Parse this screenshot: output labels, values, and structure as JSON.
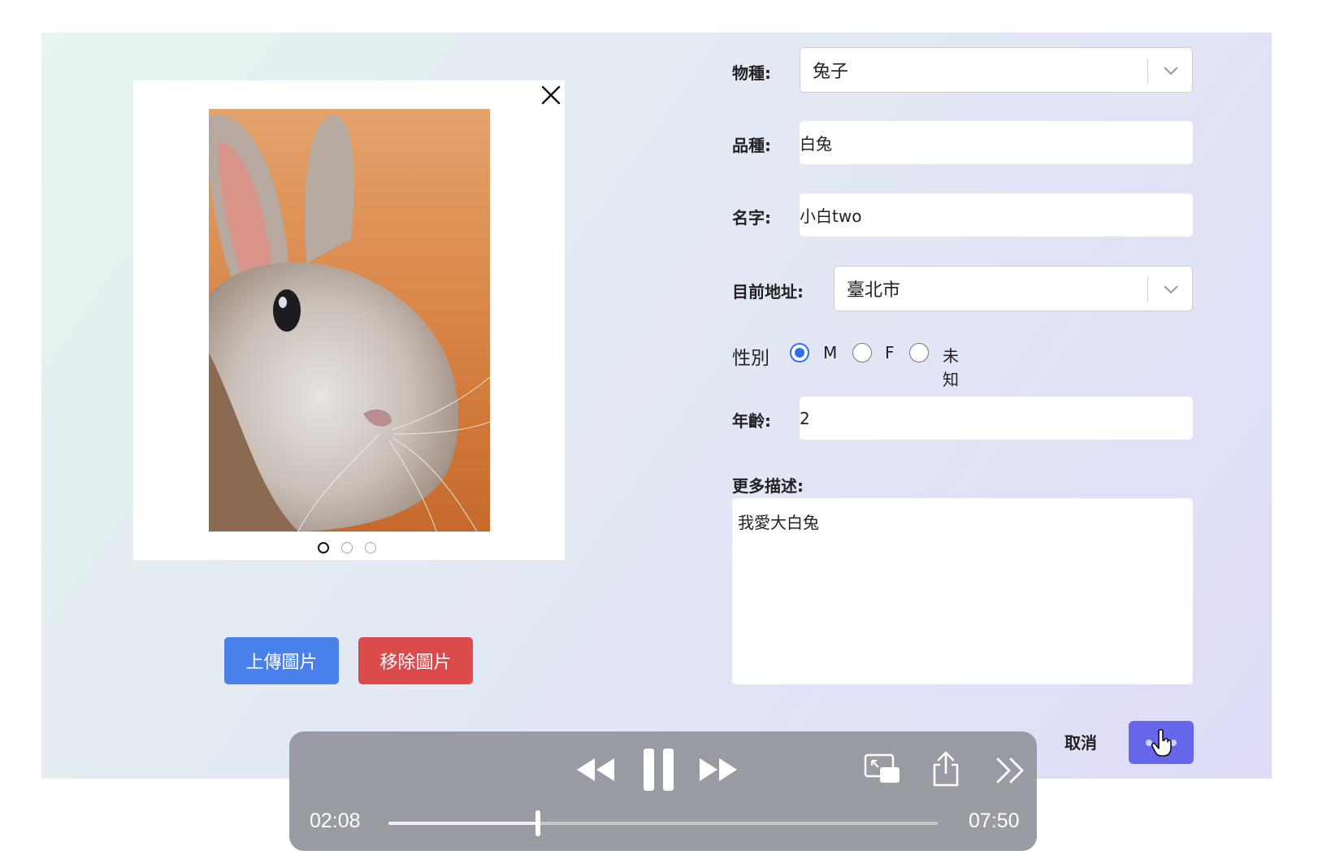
{
  "form": {
    "species": {
      "label": "物種:",
      "value": "兔子"
    },
    "breed": {
      "label": "品種:",
      "value": "白兔"
    },
    "name": {
      "label": "名字:",
      "value": "小白two"
    },
    "address": {
      "label": "目前地址:",
      "value": "臺北市"
    },
    "gender": {
      "label": "性別",
      "options": [
        "M",
        "F",
        "未知"
      ],
      "selected": "M"
    },
    "age": {
      "label": "年齡:",
      "value": "2"
    },
    "description": {
      "label": "更多描述:",
      "value": "我愛大白兔"
    },
    "cancel_label": "取消"
  },
  "image_panel": {
    "upload_label": "上傳圖片",
    "remove_label": "移除圖片",
    "carousel_count": 3,
    "carousel_active": 1
  },
  "player": {
    "current_time": "02:08",
    "total_time": "07:50",
    "progress": 0.2723
  },
  "colors": {
    "upload": "#4a80ea",
    "remove": "#dc4b4b",
    "submit": "#6566ea",
    "radio_checked": "#2f6fea"
  }
}
